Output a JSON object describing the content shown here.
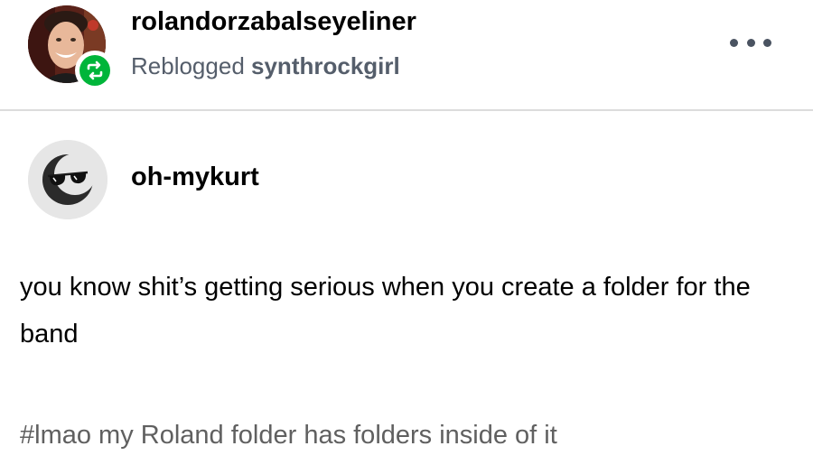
{
  "header": {
    "blog_name": "rolandorzabalseyeliner",
    "reblog_prefix": "Reblogged",
    "reblog_source": "synthrockgirl",
    "avatar_icon": "user-photo-avatar",
    "reblog_icon": "reblog-icon",
    "more_icon": "more-options-icon"
  },
  "trail": {
    "blog_name": "oh-mykurt",
    "avatar_icon": "sunglasses-moon-avatar"
  },
  "post": {
    "body": "you know shit’s getting serious when you create a folder for the band",
    "tags": "#lmao my Roland folder has folders inside of it"
  },
  "colors": {
    "reblog_green": "#00b53a",
    "secondary_text": "#555e6b",
    "tag_text": "#606060",
    "divider": "#dcdcdc"
  }
}
